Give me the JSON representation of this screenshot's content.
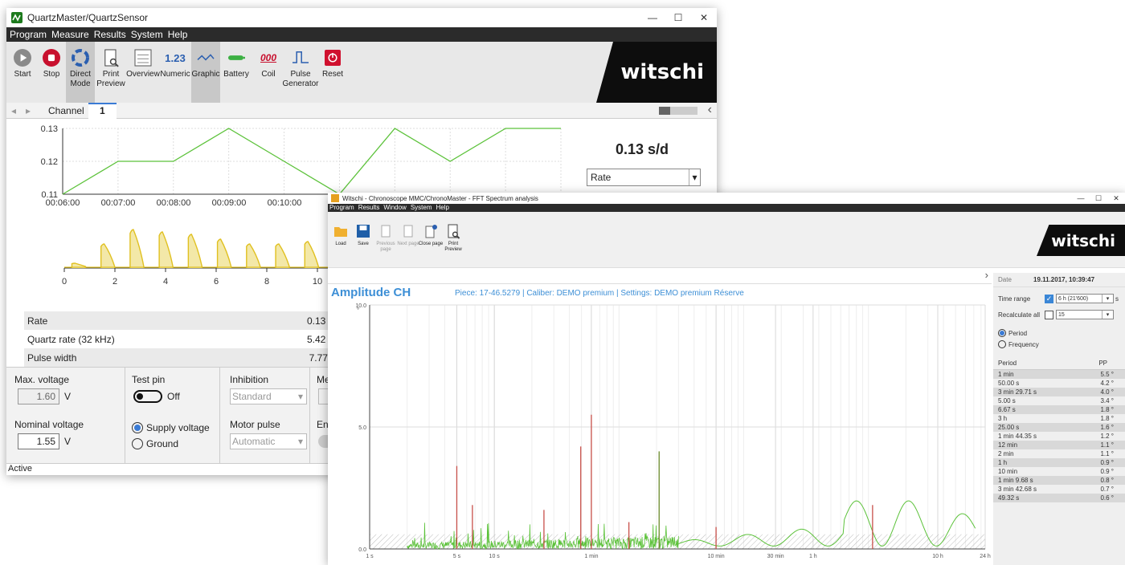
{
  "win1": {
    "title": "QuartzMaster/QuartzSensor",
    "menu": [
      "Program",
      "Measure",
      "Results",
      "System",
      "Help"
    ],
    "toolbar": [
      {
        "label": "Start",
        "icon": "play-icon"
      },
      {
        "label": "Stop",
        "icon": "stop-icon"
      },
      {
        "label": "Direct\nMode",
        "icon": "direct-mode-icon",
        "active": true
      },
      {
        "label": "Print\nPreview",
        "icon": "print-preview-icon"
      },
      {
        "label": "Overview",
        "icon": "overview-icon"
      },
      {
        "label": "Numeric",
        "icon": "numeric-icon"
      },
      {
        "label": "Graphic",
        "icon": "graphic-icon",
        "active": true
      },
      {
        "label": "Battery",
        "icon": "battery-icon"
      },
      {
        "label": "Coil",
        "icon": "coil-icon"
      },
      {
        "label": "Pulse\nGenerator",
        "icon": "pulse-generator-icon"
      },
      {
        "label": "Reset",
        "icon": "reset-icon"
      }
    ],
    "numeric_glyph": "1.23",
    "coil_glyph": "000",
    "logo": "witschi",
    "tab_label": "Channel",
    "tab_value": "1",
    "chart1": {
      "type": "line",
      "y_ticks": [
        "0.13",
        "0.12",
        "0.11"
      ],
      "x_ticks": [
        "00:06:00",
        "00:07:00",
        "00:08:00",
        "00:09:00",
        "00:10:00",
        "0"
      ],
      "x": [
        0,
        1,
        2,
        3,
        4,
        5,
        6,
        7,
        8,
        9
      ],
      "y": [
        0.11,
        0.12,
        0.12,
        0.13,
        0.12,
        0.11,
        0.13,
        0.12,
        0.13,
        0.13
      ],
      "color": "#5cc23a"
    },
    "readout_value": "0.13 s/d",
    "readout_select": "Rate",
    "chart2": {
      "type": "area",
      "x_ticks": [
        "0",
        "2",
        "4",
        "6",
        "8",
        "10"
      ],
      "pulse_peaks": [
        0.1,
        0.5,
        0.8,
        0.75,
        0.7,
        0.6,
        0.5,
        0.5,
        0.55
      ],
      "color": "#e0c020"
    },
    "table": [
      {
        "label": "Rate",
        "value": "0.13 s,"
      },
      {
        "label": "Quartz rate (32 kHz)",
        "value": "5.42 s,"
      },
      {
        "label": "Pulse width",
        "value": "7.77 n"
      }
    ],
    "controls": {
      "max_voltage_label": "Max. voltage",
      "max_voltage": "1.60",
      "v1": "V",
      "nominal_voltage_label": "Nominal voltage",
      "nominal_voltage": "1.55",
      "v2": "V",
      "test_pin_label": "Test pin",
      "test_pin_state": "Off",
      "radio_supply": "Supply voltage",
      "radio_ground": "Ground",
      "inhibition_label": "Inhibition",
      "inhibition_value": "Standard",
      "motor_pulse_label": "Motor pulse",
      "motor_pulse_value": "Automatic",
      "me_label": "Me",
      "en_label": "En"
    },
    "status": "Active"
  },
  "win2": {
    "title": "Witschi - Chronoscope MMC/ChronoMaster - FFT Spectrum analysis",
    "menu": [
      "Program",
      "Results",
      "Window",
      "System",
      "Help"
    ],
    "toolbar": [
      {
        "label": "Load",
        "icon": "folder-icon"
      },
      {
        "label": "Save",
        "icon": "save-icon"
      },
      {
        "label": "Previous\npage",
        "icon": "previous-page-icon",
        "disabled": true
      },
      {
        "label": "Next page",
        "icon": "next-page-icon",
        "disabled": true
      },
      {
        "label": "Close page",
        "icon": "close-page-icon"
      },
      {
        "label": "Print\nPreview",
        "icon": "print-preview-icon"
      }
    ],
    "logo": "witschi",
    "chart_title": "Amplitude CH",
    "chart_subtitle": "Piece: 17-46.5279 | Caliber: DEMO premium | Settings: DEMO premium Réserve",
    "y_unit": "°",
    "chart_data": {
      "type": "line",
      "title": "Amplitude CH",
      "y_ticks": [
        "10.0",
        "5.0",
        "0.0"
      ],
      "ylim": [
        0,
        10
      ],
      "x_scale": "log",
      "x_ticks": [
        {
          "label": "1 s",
          "s": 1
        },
        {
          "label": "5 s",
          "s": 5
        },
        {
          "label": "10 s",
          "s": 10
        },
        {
          "label": "1 min",
          "s": 60
        },
        {
          "label": "10 min",
          "s": 600
        },
        {
          "label": "30 min",
          "s": 1800
        },
        {
          "label": "1 h",
          "s": 3600
        },
        {
          "label": "10 h",
          "s": 36000
        },
        {
          "label": "24 h",
          "s": 86400
        }
      ],
      "spikes": [
        {
          "s": 5,
          "v": 3.4,
          "color": "#c8504a"
        },
        {
          "s": 6.67,
          "v": 1.8,
          "color": "#c8504a"
        },
        {
          "s": 25,
          "v": 1.6,
          "color": "#c8504a"
        },
        {
          "s": 49.32,
          "v": 4.2,
          "color": "#c8504a"
        },
        {
          "s": 60,
          "v": 5.5,
          "color": "#c8504a"
        },
        {
          "s": 120,
          "v": 1.1,
          "color": "#c8504a"
        },
        {
          "s": 209.71,
          "v": 4.0,
          "color": "#6a8a2a"
        },
        {
          "s": 600,
          "v": 0.9,
          "color": "#c8504a"
        },
        {
          "s": 10800,
          "v": 1.8,
          "color": "#c8504a"
        }
      ],
      "threshold": 0.6,
      "color": "#5cc23a"
    },
    "side": {
      "date_label": "Date",
      "date_value": "19.11.2017, 10:39:47",
      "time_range_label": "Time range",
      "time_range_value": "6 h (21'600)",
      "time_unit": "s",
      "recalc_label": "Recalculate all",
      "recalc_value": "15",
      "radio_period": "Period",
      "radio_frequency": "Frequency",
      "col_period": "Period",
      "col_pp": "PP",
      "rows": [
        [
          "1 min",
          "5.5 °"
        ],
        [
          "50.00 s",
          "4.2 °"
        ],
        [
          "3 min 29.71 s",
          "4.0 °"
        ],
        [
          "5.00 s",
          "3.4 °"
        ],
        [
          "6.67 s",
          "1.8 °"
        ],
        [
          "3 h",
          "1.8 °"
        ],
        [
          "25.00 s",
          "1.6 °"
        ],
        [
          "1 min 44.35 s",
          "1.2 °"
        ],
        [
          "12 min",
          "1.1 °"
        ],
        [
          "2 min",
          "1.1 °"
        ],
        [
          "1 h",
          "0.9 °"
        ],
        [
          "10 min",
          "0.9 °"
        ],
        [
          "1 min 9.68 s",
          "0.8 °"
        ],
        [
          "3 min 42.68 s",
          "0.7 °"
        ],
        [
          "49.32 s",
          "0.6 °"
        ]
      ]
    }
  }
}
